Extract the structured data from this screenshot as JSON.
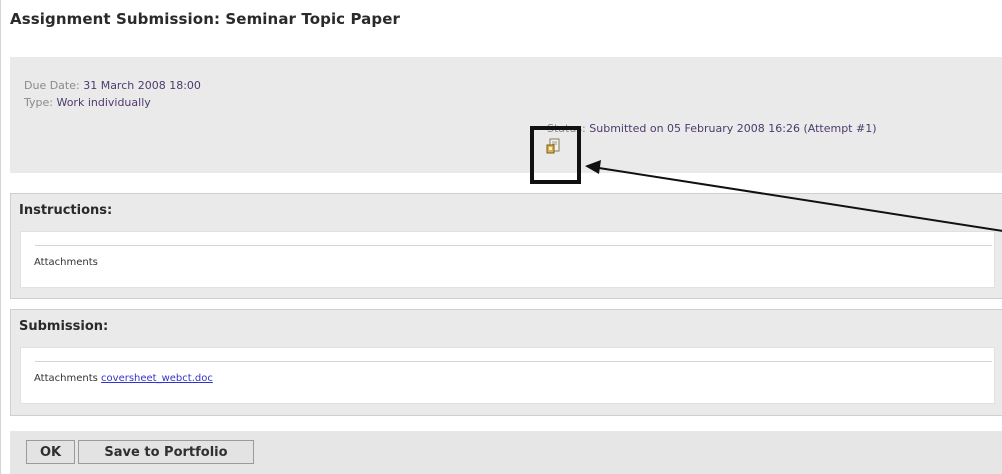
{
  "page": {
    "title": "Assignment Submission: Seminar Topic Paper"
  },
  "meta": {
    "due_label": "Due Date: ",
    "due_value": "31 March 2008 18:00",
    "type_label": "Type: ",
    "type_value": "Work individually",
    "status_label": "Status: ",
    "status_value": "Submitted on 05 February 2008 16:26 (Attempt #1)",
    "status_icon": "submitted-document-icon"
  },
  "instructions": {
    "title": "Instructions:",
    "attachments_label": "Attachments"
  },
  "submission": {
    "title": "Submission:",
    "attachments_label": "Attachments",
    "file_link": "coversheet_webct.doc"
  },
  "buttons": {
    "ok_label": "OK",
    "save_label": "Save to Portfolio"
  },
  "colors": {
    "panel_bg": "#eaeaea",
    "link": "#3333cc",
    "meta_value": "#4d3a6e",
    "annotation": "#111111"
  }
}
